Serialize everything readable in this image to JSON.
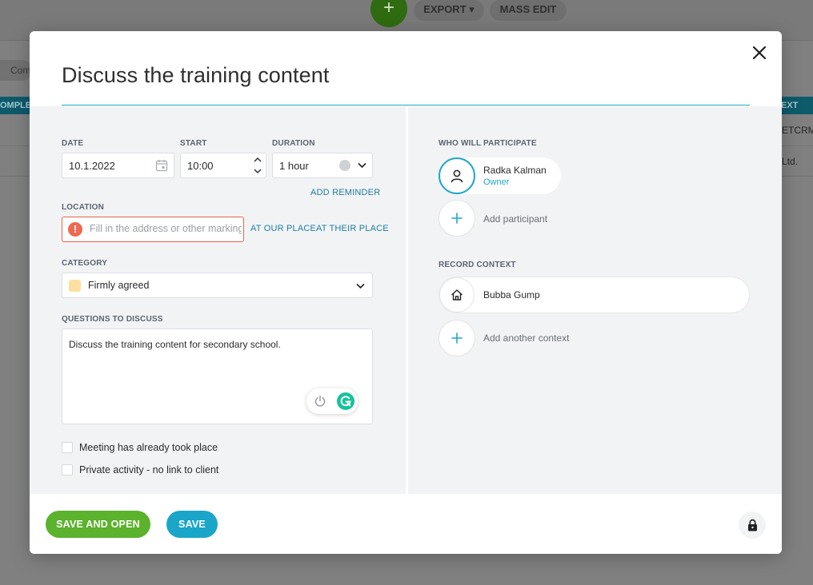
{
  "background": {
    "export_label": "EXPORT",
    "mass_edit_label": "MASS EDIT",
    "add_icon": "+",
    "filter_chip": "Com",
    "left_column_header": "OMPLET",
    "right_column_header": "EXT",
    "row1_text": "ETCRM",
    "row2_text": "Ltd."
  },
  "modal": {
    "title": "Discuss the training content",
    "close_icon": "close-icon"
  },
  "form": {
    "date": {
      "label": "DATE",
      "value": "10.1.2022"
    },
    "start": {
      "label": "START",
      "value": "10:00"
    },
    "duration": {
      "label": "DURATION",
      "value": "1 hour"
    },
    "add_reminder": "ADD REMINDER",
    "location": {
      "label": "LOCATION",
      "placeholder": "Fill in the address or other marking",
      "value": "",
      "warning_icon": "!",
      "at_our_place": "AT OUR PLACE",
      "at_their_place": "AT THEIR PLACE"
    },
    "category": {
      "label": "CATEGORY",
      "value": "Firmly agreed",
      "swatch_color": "#fde0a0"
    },
    "questions": {
      "label": "QUESTIONS TO DISCUSS",
      "value": "Discuss the training content for secondary school."
    },
    "checkboxes": [
      {
        "label": "Meeting has already took place",
        "checked": false
      },
      {
        "label": "Private activity - no link to client",
        "checked": false
      }
    ]
  },
  "participants": {
    "label": "WHO WILL PARTICIPATE",
    "items": [
      {
        "name": "Radka Kalman",
        "role": "Owner"
      }
    ],
    "add_label": "Add participant"
  },
  "context": {
    "label": "RECORD CONTEXT",
    "items": [
      {
        "name": "Bubba Gump"
      }
    ],
    "add_label": "Add another context"
  },
  "footer": {
    "save_and_open": "SAVE AND OPEN",
    "save": "SAVE"
  },
  "colors": {
    "accent": "#1ea8c5",
    "save_and_open": "#5bb22c",
    "save": "#1aa6c9",
    "error": "#e2664e"
  }
}
